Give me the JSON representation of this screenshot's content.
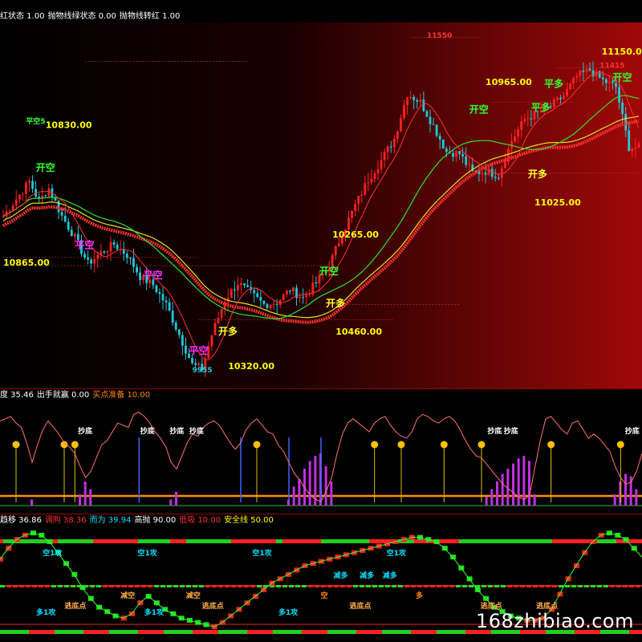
{
  "main_header": [
    {
      "text": "红状态 1.00",
      "color": "#ffffff"
    },
    {
      "text": "抛物线绿状态 0.00",
      "color": "#ffffff"
    },
    {
      "text": "抛物线转红 1.00",
      "color": "#ffffff"
    }
  ],
  "indicator1_header": [
    {
      "text": "度 35.46",
      "color": "#ffffff"
    },
    {
      "text": "出手就赢 0.00",
      "color": "#ffffff"
    },
    {
      "text": "买点准备 10.00",
      "color": "#ff8800"
    }
  ],
  "indicator2_header": [
    {
      "text": "趋移 36.86",
      "color": "#ffffff"
    },
    {
      "text": "调购 38.36",
      "color": "#ff3030"
    },
    {
      "text": "而为 39.94",
      "color": "#00e0ff"
    },
    {
      "text": "高抛 90.00",
      "color": "#ffffff"
    },
    {
      "text": "低吸 10.00",
      "color": "#ff3030"
    },
    {
      "text": "安全线 50.00",
      "color": "#ffff00"
    }
  ],
  "watermark": "168zhibiao.com",
  "colors": {
    "up": "#ff2020",
    "down": "#20c8d8",
    "ma_green": "#30e030",
    "ma_red": "#ff2020",
    "signal_green": "#30ff30",
    "signal_yellow": "#ffff30",
    "signal_magenta": "#ff30ff",
    "price_label": "#ffff00"
  },
  "chart_data": [
    {
      "type": "candlestick",
      "ylim": [
        9900,
        11600
      ],
      "x_count": 160,
      "close_path": [
        [
          0,
          10700
        ],
        [
          4,
          10780
        ],
        [
          8,
          10860
        ],
        [
          11,
          10770
        ],
        [
          14,
          10830
        ],
        [
          18,
          10700
        ],
        [
          22,
          10600
        ],
        [
          26,
          10480
        ],
        [
          30,
          10530
        ],
        [
          34,
          10570
        ],
        [
          38,
          10520
        ],
        [
          42,
          10420
        ],
        [
          46,
          10380
        ],
        [
          50,
          10290
        ],
        [
          54,
          10150
        ],
        [
          58,
          10010
        ],
        [
          61,
          9990
        ],
        [
          64,
          10150
        ],
        [
          68,
          10310
        ],
        [
          72,
          10390
        ],
        [
          76,
          10340
        ],
        [
          80,
          10290
        ],
        [
          84,
          10300
        ],
        [
          88,
          10360
        ],
        [
          92,
          10320
        ],
        [
          96,
          10390
        ],
        [
          100,
          10470
        ],
        [
          104,
          10620
        ],
        [
          108,
          10750
        ],
        [
          112,
          10870
        ],
        [
          116,
          10960
        ],
        [
          120,
          11060
        ],
        [
          124,
          11270
        ],
        [
          128,
          11230
        ],
        [
          132,
          11120
        ],
        [
          136,
          11000
        ],
        [
          140,
          10990
        ],
        [
          144,
          10900
        ],
        [
          148,
          10910
        ],
        [
          152,
          10890
        ],
        [
          156,
          11050
        ],
        [
          160,
          11150
        ],
        [
          164,
          11180
        ],
        [
          168,
          11210
        ],
        [
          172,
          11260
        ],
        [
          176,
          11350
        ],
        [
          180,
          11380
        ],
        [
          184,
          11330
        ],
        [
          188,
          11300
        ],
        [
          192,
          11020
        ]
      ],
      "price_labels": [
        {
          "text": "11550",
          "x": 130,
          "y": 11530,
          "color": "#ff3030"
        },
        {
          "text": "11415",
          "x": 183,
          "y": 11390,
          "color": "#ff3030"
        },
        {
          "text": "11150.00",
          "x": 194,
          "y": 11450,
          "color": "#ffff00"
        },
        {
          "text": "10965.00",
          "x": 148,
          "y": 11310,
          "color": "#ffff00"
        },
        {
          "text": "10830.00",
          "x": 13,
          "y": 11110,
          "color": "#ffff00"
        },
        {
          "text": "11025.00",
          "x": 163,
          "y": 10750,
          "color": "#ffff00"
        },
        {
          "text": "10865.00",
          "x": 0,
          "y": 10470,
          "color": "#ffff00"
        },
        {
          "text": "10265.00",
          "x": 101,
          "y": 10600,
          "color": "#ffff00"
        },
        {
          "text": "10460.00",
          "x": 102,
          "y": 10150,
          "color": "#ffff00"
        },
        {
          "text": "10320.00",
          "x": 69,
          "y": 9990,
          "color": "#ffff00"
        },
        {
          "text": "9955",
          "x": 58,
          "y": 9975,
          "color": "#20c8d8"
        }
      ],
      "signals": [
        {
          "text": "平空5",
          "x": 7,
          "y": 11130,
          "color": "#30ff30"
        },
        {
          "text": "开空",
          "x": 10,
          "y": 10910,
          "color": "#30ff30"
        },
        {
          "text": "平空",
          "x": 22,
          "y": 10550,
          "color": "#ff30ff"
        },
        {
          "text": "平空",
          "x": 43,
          "y": 10410,
          "color": "#ff30ff"
        },
        {
          "text": "平空",
          "x": 57,
          "y": 10060,
          "color": "#ff30ff"
        },
        {
          "text": "开多",
          "x": 66,
          "y": 10150,
          "color": "#ffff30"
        },
        {
          "text": "开空",
          "x": 97,
          "y": 10430,
          "color": "#30ff30"
        },
        {
          "text": "开多",
          "x": 99,
          "y": 10280,
          "color": "#ffff30"
        },
        {
          "text": "开空",
          "x": 143,
          "y": 11180,
          "color": "#30ff30"
        },
        {
          "text": "开多",
          "x": 161,
          "y": 10880,
          "color": "#ffff30"
        },
        {
          "text": "平多",
          "x": 162,
          "y": 11190,
          "color": "#30ff30"
        },
        {
          "text": "平多",
          "x": 166,
          "y": 11300,
          "color": "#30ff30"
        },
        {
          "text": "开空",
          "x": 187,
          "y": 11330,
          "color": "#30ff30"
        }
      ]
    },
    {
      "type": "line",
      "ylim": [
        0,
        100
      ],
      "series": [
        {
          "color": "#ff7070",
          "values": [
            82,
            84,
            86,
            80,
            76,
            62,
            44,
            60,
            74,
            82,
            76,
            70,
            62,
            58,
            52,
            40,
            30,
            36,
            48,
            60,
            64,
            72,
            80,
            78,
            76,
            88,
            90,
            86,
            80,
            72,
            66,
            58,
            44,
            38,
            50,
            62,
            70,
            68,
            76,
            80,
            82,
            78,
            70,
            62,
            56,
            62,
            74,
            80,
            84,
            78,
            72,
            70,
            60,
            54,
            44,
            34,
            28,
            20,
            14,
            10,
            8,
            18,
            30,
            52,
            70,
            80,
            84,
            80,
            76,
            72,
            80,
            84,
            86,
            78,
            72,
            68,
            66,
            72,
            84,
            88,
            86,
            82,
            80,
            84,
            86,
            82,
            74,
            64,
            56,
            50,
            48,
            42,
            36,
            30,
            24,
            20,
            16,
            12,
            10,
            14,
            40,
            64,
            84,
            86,
            80,
            74,
            70,
            80,
            82,
            74,
            66,
            70,
            66,
            60,
            54,
            40,
            30,
            24,
            26,
            36,
            52
          ]
        }
      ],
      "labels": [
        {
          "text": "抄底",
          "x": 26,
          "color": "#ffffff"
        },
        {
          "text": "抄底",
          "x": 45,
          "color": "#ffffff"
        },
        {
          "text": "抄底",
          "x": 54,
          "color": "#ffffff"
        },
        {
          "text": "抄底",
          "x": 60,
          "color": "#ffffff"
        },
        {
          "text": "抄底",
          "x": 151,
          "color": "#ffffff"
        },
        {
          "text": "抄底",
          "x": 156,
          "color": "#ffffff"
        },
        {
          "text": "抄底",
          "x": 193,
          "color": "#ffffff"
        }
      ]
    },
    {
      "type": "line",
      "ylim": [
        0,
        100
      ],
      "series": [
        {
          "color": "mixed",
          "values": [
            70,
            80,
            88,
            92,
            94,
            92,
            86,
            76,
            66,
            56,
            44,
            34,
            26,
            22,
            18,
            16,
            20,
            30,
            36,
            30,
            24,
            20,
            16,
            14,
            12,
            10,
            8,
            12,
            18,
            24,
            30,
            36,
            42,
            48,
            52,
            56,
            60,
            64,
            66,
            68,
            70,
            72,
            74,
            76,
            78,
            80,
            82,
            84,
            86,
            88,
            90,
            90,
            88,
            86,
            80,
            72,
            62,
            52,
            42,
            34,
            26,
            22,
            18,
            16,
            14,
            14,
            16,
            24,
            38,
            52,
            64,
            76,
            86,
            92,
            94,
            92,
            88,
            80,
            72
          ]
        }
      ],
      "labels": [
        {
          "text": "空1攻",
          "x": 16,
          "color": "#00e0ff"
        },
        {
          "text": "空1攻",
          "x": 45,
          "color": "#00e0ff"
        },
        {
          "text": "空1攻",
          "x": 80,
          "color": "#00e0ff"
        },
        {
          "text": "空1攻",
          "x": 121,
          "color": "#00e0ff"
        },
        {
          "text": "多1攻",
          "x": 14,
          "color": "#00e0ff"
        },
        {
          "text": "多1攻",
          "x": 47,
          "color": "#00e0ff"
        },
        {
          "text": "多1攻",
          "x": 88,
          "color": "#00e0ff"
        },
        {
          "text": "逃底点",
          "x": 23,
          "color": "#ffaa44"
        },
        {
          "text": "逃底点",
          "x": 65,
          "color": "#ffaa44"
        },
        {
          "text": "逃底点",
          "x": 110,
          "color": "#ffaa44"
        },
        {
          "text": "逃底点",
          "x": 150,
          "color": "#ffaa44"
        },
        {
          "text": "逃底点",
          "x": 167,
          "color": "#ffaa44"
        },
        {
          "text": "减空",
          "x": 39,
          "color": "#ffaa44"
        },
        {
          "text": "减空",
          "x": 59,
          "color": "#ffaa44"
        },
        {
          "text": "减多",
          "x": 104,
          "color": "#00e0ff"
        },
        {
          "text": "减多",
          "x": 112,
          "color": "#00e0ff"
        },
        {
          "text": "减多",
          "x": 119,
          "color": "#00e0ff"
        },
        {
          "text": "多",
          "x": 128,
          "color": "#ff8800"
        },
        {
          "text": "空",
          "x": 99,
          "color": "#ff8800"
        }
      ]
    }
  ]
}
